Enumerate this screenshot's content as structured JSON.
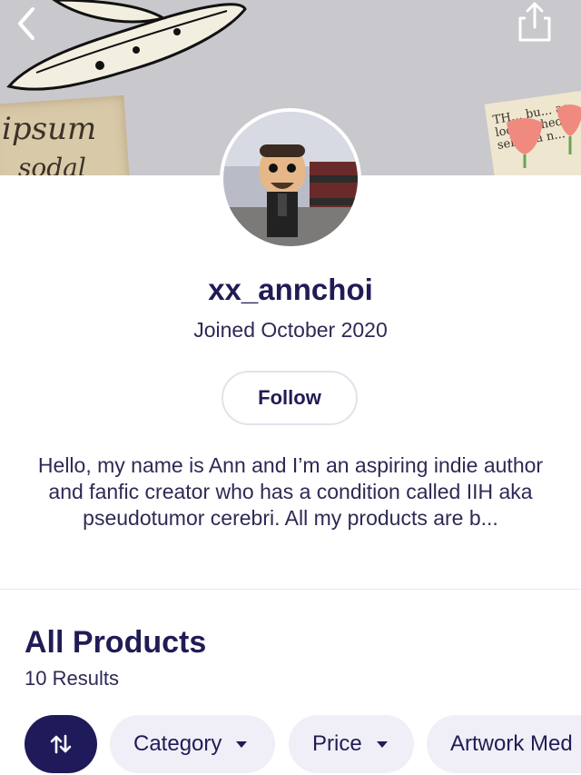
{
  "banner": {
    "decor_text_left_1": "ipsum",
    "decor_text_left_2": "sodal",
    "decor_text_right": "TH... bu... as looks... hed to select a n..."
  },
  "profile": {
    "username": "xx_annchoi",
    "joined": "Joined October 2020",
    "follow_label": "Follow",
    "bio": "Hello, my name is Ann and I’m an aspiring indie author and fanfic creator who has a condition called IIH aka pseudotumor cerebri. All my products are b..."
  },
  "products": {
    "title": "All Products",
    "results": "10 Results",
    "filters": [
      {
        "label": "Category"
      },
      {
        "label": "Price"
      },
      {
        "label": "Artwork Med"
      }
    ]
  },
  "icons": {
    "back": "chevron-left-icon",
    "share": "share-icon",
    "sort": "sort-arrows-icon",
    "dropdown": "caret-down-icon"
  },
  "colors": {
    "accent": "#1f1b5a",
    "chip_bg": "#f0eff7",
    "banner_bg": "#c9c8cc"
  }
}
